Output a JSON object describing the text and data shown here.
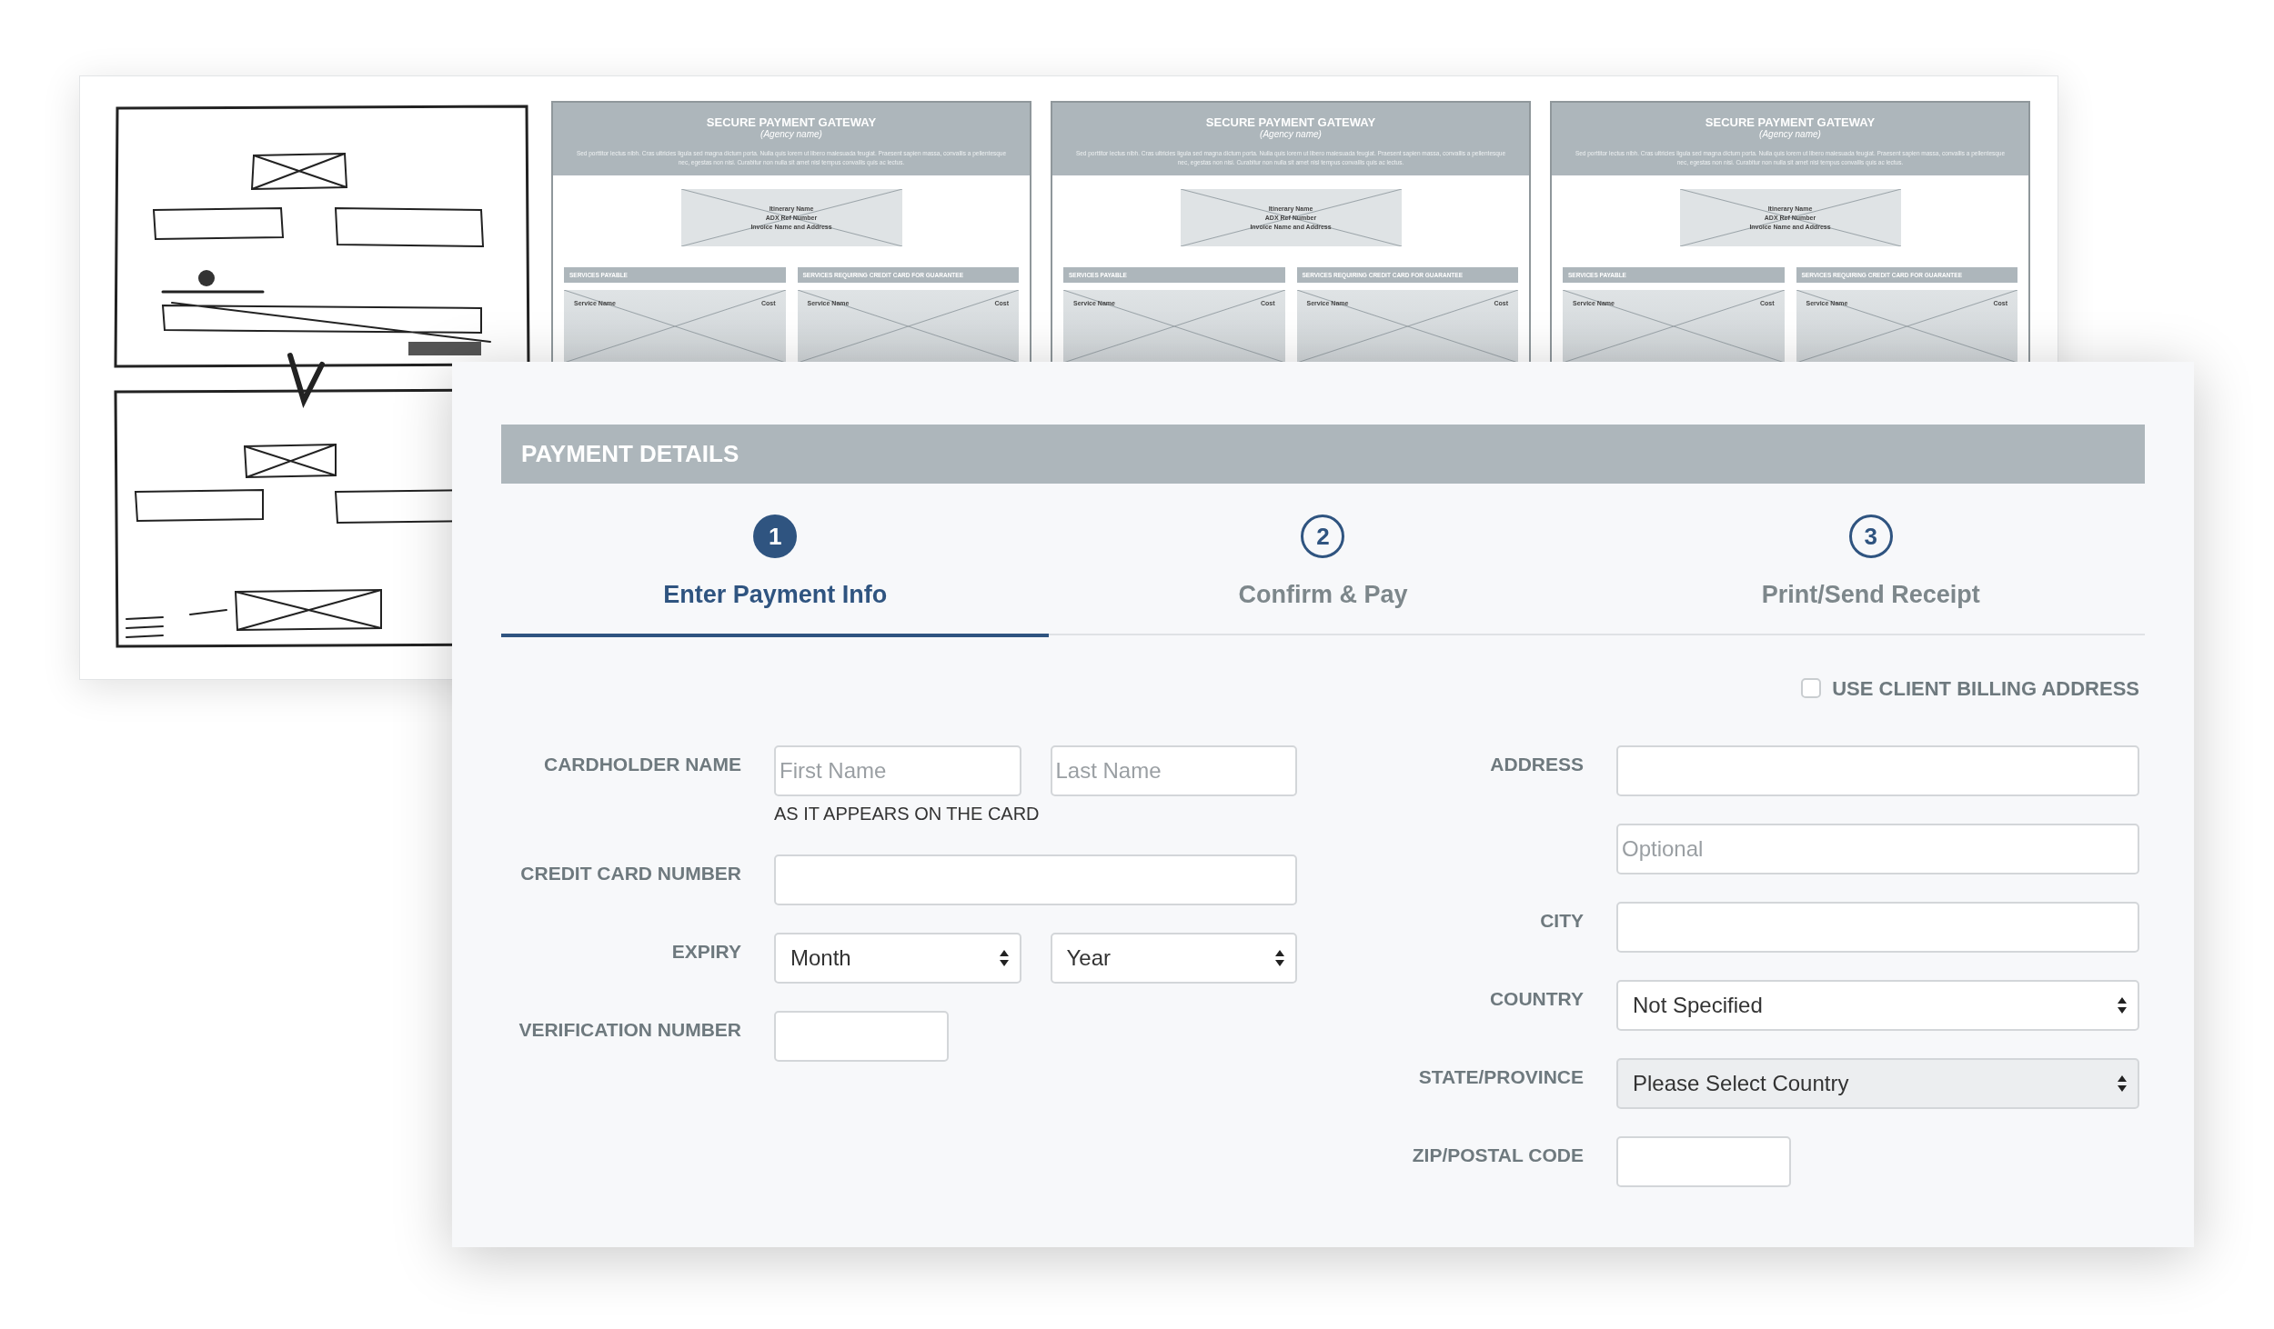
{
  "wireframes": [
    {
      "title": "SECURE PAYMENT GATEWAY",
      "subtitle": "(Agency name)",
      "description": "Sed porttitor lectus nibh. Cras ultricies ligula sed magna dictum porta. Nulla quis lorem ut libero malesuada feugiat. Praesent sapien massa, convallis a pellentesque nec, egestas non nisi. Curabitur non nulla sit amet nisl tempus convallis quis ac lectus.",
      "summary_lines": [
        "Itinerary Name",
        "ADX Ref Number",
        "Invoice Name and Address"
      ],
      "sections": [
        {
          "heading": "SERVICES PAYABLE",
          "columns": [
            "Service Name",
            "Cost"
          ]
        },
        {
          "heading": "SERVICES REQUIRING CREDIT CARD FOR GUARANTEE",
          "columns": [
            "Service Name",
            "Cost"
          ]
        }
      ]
    },
    {
      "title": "SECURE PAYMENT GATEWAY",
      "subtitle": "(Agency name)",
      "description": "Sed porttitor lectus nibh. Cras ultricies ligula sed magna dictum porta. Nulla quis lorem ut libero malesuada feugiat. Praesent sapien massa, convallis a pellentesque nec, egestas non nisi. Curabitur non nulla sit amet nisl tempus convallis quis ac lectus.",
      "summary_lines": [
        "Itinerary Name",
        "ADX Ref Number",
        "Invoice Name and Address"
      ],
      "sections": [
        {
          "heading": "SERVICES PAYABLE",
          "columns": [
            "Service Name",
            "Cost"
          ]
        },
        {
          "heading": "SERVICES REQUIRING CREDIT CARD FOR GUARANTEE",
          "columns": [
            "Service Name",
            "Cost"
          ]
        }
      ]
    },
    {
      "title": "SECURE PAYMENT GATEWAY",
      "subtitle": "(Agency name)",
      "description": "Sed porttitor lectus nibh. Cras ultricies ligula sed magna dictum porta. Nulla quis lorem ut libero malesuada feugiat. Praesent sapien massa, convallis a pellentesque nec, egestas non nisi. Curabitur non nulla sit amet nisl tempus convallis quis ac lectus.",
      "summary_lines": [
        "Itinerary Name",
        "ADX Ref Number",
        "Invoice Name and Address"
      ],
      "sections": [
        {
          "heading": "SERVICES PAYABLE",
          "columns": [
            "Service Name",
            "Cost"
          ]
        },
        {
          "heading": "SERVICES REQUIRING CREDIT CARD FOR GUARANTEE",
          "columns": [
            "Service Name",
            "Cost"
          ]
        }
      ]
    }
  ],
  "payment": {
    "title": "PAYMENT DETAILS",
    "steps": [
      {
        "number": "1",
        "label": "Enter Payment Info",
        "selected": true
      },
      {
        "number": "2",
        "label": "Confirm & Pay",
        "selected": false
      },
      {
        "number": "3",
        "label": "Print/Send Receipt",
        "selected": false
      }
    ],
    "billing_option": {
      "label": "USE CLIENT BILLING ADDRESS",
      "checked": false
    },
    "card_fields": [
      {
        "label": "CARDHOLDER NAME",
        "controls": [
          {
            "kind": "input",
            "placeholder": "First Name"
          },
          {
            "kind": "input",
            "placeholder": "Last Name"
          }
        ],
        "hint": "AS IT APPEARS ON THE CARD"
      },
      {
        "label": "CREDIT CARD NUMBER",
        "controls": [
          {
            "kind": "input"
          }
        ]
      },
      {
        "label": "EXPIRY",
        "controls": [
          {
            "kind": "select",
            "value": "Month",
            "disabled": false
          },
          {
            "kind": "select",
            "value": "Year",
            "disabled": false
          }
        ]
      },
      {
        "label": "VERIFICATION NUMBER",
        "controls": [
          {
            "kind": "short-input"
          }
        ]
      }
    ],
    "address_fields": [
      {
        "label": "ADDRESS",
        "controls": [
          {
            "kind": "input"
          }
        ]
      },
      {
        "controls": [
          {
            "kind": "input",
            "placeholder": "Optional"
          }
        ]
      },
      {
        "label": "CITY",
        "controls": [
          {
            "kind": "input"
          }
        ]
      },
      {
        "label": "COUNTRY",
        "controls": [
          {
            "kind": "select",
            "value": "Not Specified",
            "disabled": false
          }
        ]
      },
      {
        "label": "STATE/PROVINCE",
        "controls": [
          {
            "kind": "select",
            "value": "Please Select Country",
            "disabled": true
          }
        ]
      },
      {
        "label": "ZIP/POSTAL CODE",
        "controls": [
          {
            "kind": "short-input"
          }
        ]
      }
    ]
  }
}
